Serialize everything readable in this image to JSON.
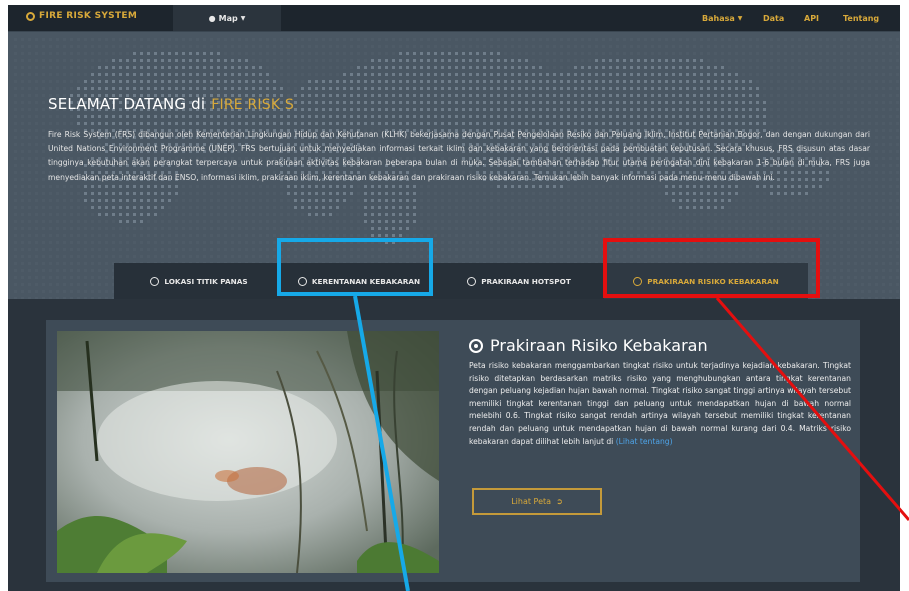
{
  "navbar": {
    "brand": "FIRE RISK SYSTEM",
    "map_menu": "Map",
    "bahasa_menu": "Bahasa",
    "data_link": "Data",
    "api_link": "API",
    "tentang_link": "Tentang"
  },
  "hero": {
    "welcome": "SELAMAT DATANG di",
    "highlight": "FIRE RISK S",
    "intro": "Fire Risk System (FRS) dibangun oleh Kementerian Lingkungan Hidup dan Kehutanan (KLHK) bekerjasama dengan Pusat Pengelolaan Resiko dan Peluang Iklim, Institut Pertanian Bogor, dan dengan dukungan dari United Nations Environment Programme (UNEP). FRS bertujuan untuk menyediakan informasi terkait iklim dan kebakaran yang berorientasi pada pembuatan keputusan. Secara khusus, FRS disusun atas dasar tingginya kebutuhan akan perangkat terpercaya untuk prakiraan aktivitas kebakaran beberapa bulan di muka. Sebagai tambahan terhadap fitur utama peringatan dini kebakaran 1-6 bulan di muka, FRS juga menyediakan peta interaktif dan ENSO, informasi iklim, prakiraan iklim, kerentanan kebakaran dan prakiraan risiko kebakaran. Temukan lebih banyak informasi pada menu-menu dibawah ini."
  },
  "tabs": [
    {
      "label": "LOKASI TITIK PANAS"
    },
    {
      "label": "KERENTANAN KEBAKARAN"
    },
    {
      "label": "PRAKIRAAN HOTSPOT"
    },
    {
      "label": "PRAKIRAAN RISIKO KEBAKARAN"
    }
  ],
  "panel": {
    "title": "Prakiraan Risiko Kebakaran",
    "description": "Peta risiko kebakaran menggambarkan tingkat risiko untuk terjadinya kejadian kebakaran. Tingkat risiko ditetapkan berdasarkan matriks risiko yang menghubungkan antara tingkat kerentanan dengan peluang kejadian hujan bawah normal. Tingkat risiko sangat tinggi artinya wilayah tersebut memiliki tingkat kerentanan tinggi dan peluang untuk mendapatkan hujan di bawah normal melebihi 0.6. Tingkat risiko sangat rendah artinya wilayah tersebut memiliki tingkat kerentanan rendah dan peluang untuk mendapatkan hujan di bawah normal kurang dari 0.4. Matriks risiko kebakaran dapat dilihat lebih lanjut di",
    "link": "(Lihat tentang)",
    "button": "Lihat Peta"
  },
  "colors": {
    "accent": "#d8a93a",
    "annotation_blue": "#16a9e8",
    "annotation_red": "#e40f0f"
  }
}
